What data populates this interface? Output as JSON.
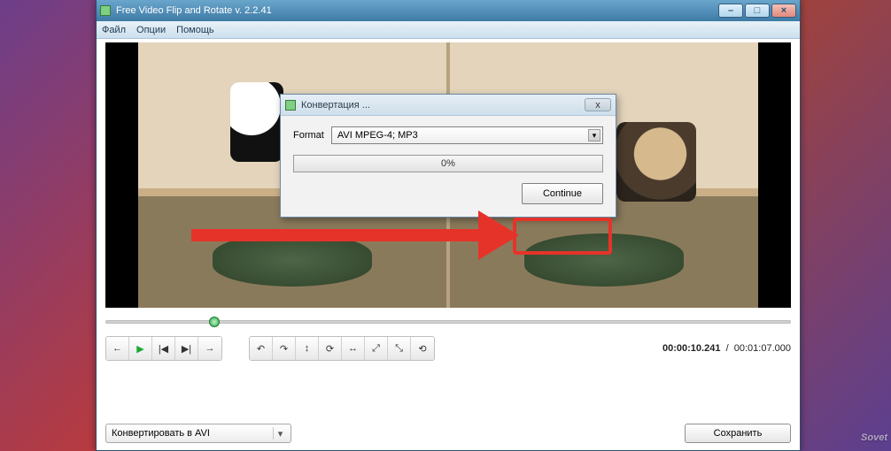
{
  "window": {
    "title": "Free Video Flip and Rotate v. 2.2.41",
    "min_glyph": "–",
    "max_glyph": "□",
    "close_glyph": "×"
  },
  "menu": {
    "file": "Файл",
    "options": "Опции",
    "help": "Помощь"
  },
  "timeline": {
    "knob_position": "15%"
  },
  "timecode": {
    "current": "00:00:10.241",
    "separator": "/",
    "total": "00:01:07.000"
  },
  "transport": {
    "back": "←",
    "play": "▶",
    "prev": "|◀",
    "next": "▶|",
    "fwd": "→"
  },
  "rotate": {
    "rccw": "↶",
    "rcw": "↷",
    "flipv": "↕",
    "r180": "⟳",
    "fliph": "↔",
    "d1": "⤢",
    "d2": "⤡",
    "reset": "⟲"
  },
  "convert": {
    "combo_label": "Конвертировать в AVI",
    "save_label": "Сохранить"
  },
  "dialog": {
    "title": "Конвертация ...",
    "format_label": "Format",
    "format_value": "AVI MPEG-4; MP3",
    "progress_text": "0%",
    "continue_label": "Continue",
    "close_glyph": "x"
  },
  "watermark": "Sovet",
  "bg_colors": [
    "#6d3e8a",
    "#c93a2d",
    "#e08a1e",
    "#2f5aa8",
    "#7d2e7a",
    "#3b6aa0",
    "#b04329",
    "#5c3f90"
  ]
}
